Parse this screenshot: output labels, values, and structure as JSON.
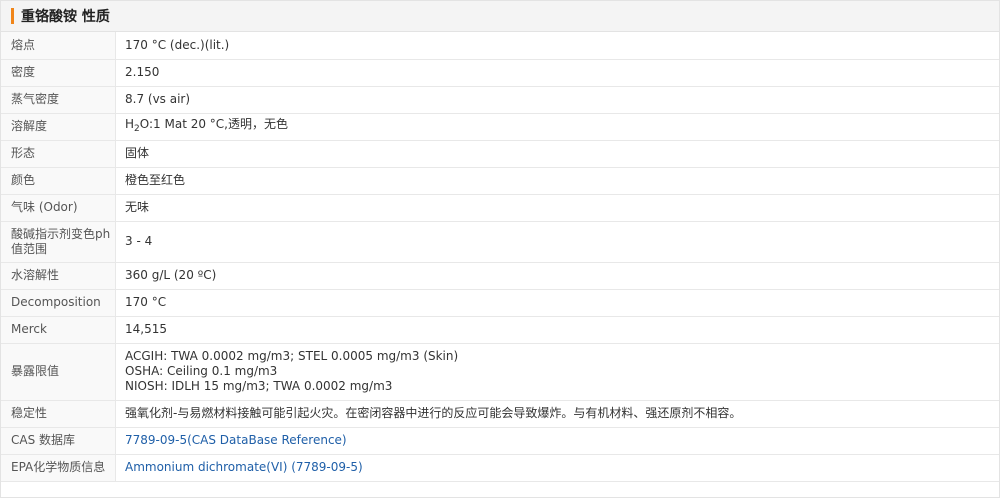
{
  "header": {
    "title": "重铬酸铵 性质"
  },
  "rows": [
    {
      "label": "熔点",
      "value": "170 °C (dec.)(lit.)"
    },
    {
      "label": "密度",
      "value": "2.150"
    },
    {
      "label": "蒸气密度",
      "value": "8.7 (vs air)"
    },
    {
      "label": "溶解度",
      "value_parts": {
        "pre": "H",
        "sub": "2",
        "post": "O:1 Mat 20 °C,透明，无色"
      }
    },
    {
      "label": "形态",
      "value": "固体"
    },
    {
      "label": "颜色",
      "value": "橙色至红色"
    },
    {
      "label": "气味 (Odor)",
      "value": "无味"
    },
    {
      "label": "酸碱指示剂变色ph值范围",
      "value": "3 - 4"
    },
    {
      "label": "水溶解性",
      "value": "360 g/L (20 ºC)"
    },
    {
      "label": "Decomposition",
      "value": "170 °C"
    },
    {
      "label": "Merck",
      "value": "14,515"
    },
    {
      "label": "暴露限值",
      "lines": [
        "ACGIH: TWA 0.0002 mg/m3; STEL 0.0005 mg/m3 (Skin)",
        "OSHA: Ceiling 0.1 mg/m3",
        "NIOSH: IDLH 15 mg/m3; TWA 0.0002 mg/m3"
      ]
    },
    {
      "label": "稳定性",
      "value": "强氧化剂-与易燃材料接触可能引起火灾。在密闭容器中进行的反应可能会导致爆炸。与有机材料、强还原剂不相容。"
    },
    {
      "label": "CAS 数据库",
      "link": "7789-09-5(CAS DataBase Reference)"
    },
    {
      "label": "EPA化学物质信息",
      "link": "Ammonium dichromate(VI) (7789-09-5)"
    }
  ],
  "colors": {
    "accent": "#f08519",
    "link": "#1f5fa8",
    "header_bg": "#f4f4f4",
    "label_bg": "#f9f9f9"
  }
}
